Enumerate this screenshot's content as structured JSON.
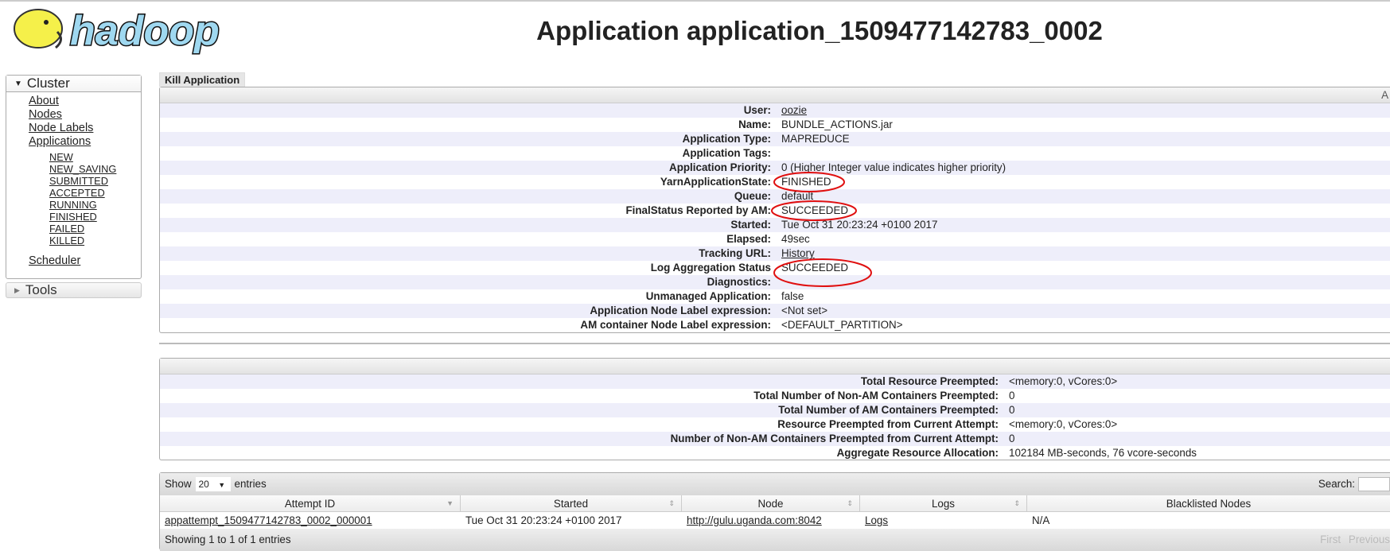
{
  "logo": {
    "text": "hadoop"
  },
  "title": "Application application_1509477142783_0002",
  "sidebar": {
    "cluster": "Cluster",
    "links": [
      "About",
      "Nodes",
      "Node Labels",
      "Applications"
    ],
    "states": [
      "NEW",
      "NEW_SAVING",
      "SUBMITTED",
      "ACCEPTED",
      "RUNNING",
      "FINISHED",
      "FAILED",
      "KILLED"
    ],
    "scheduler": "Scheduler",
    "tools": "Tools"
  },
  "kill_button": "Kill Application",
  "info_header": "A",
  "info": [
    {
      "label": "User:",
      "value": "oozie",
      "link": true
    },
    {
      "label": "Name:",
      "value": "BUNDLE_ACTIONS.jar"
    },
    {
      "label": "Application Type:",
      "value": "MAPREDUCE"
    },
    {
      "label": "Application Tags:",
      "value": ""
    },
    {
      "label": "Application Priority:",
      "value": "0 (Higher Integer value indicates higher priority)"
    },
    {
      "label": "YarnApplicationState:",
      "value": "FINISHED"
    },
    {
      "label": "Queue:",
      "value": "default"
    },
    {
      "label": "FinalStatus Reported by AM:",
      "value": "SUCCEEDED"
    },
    {
      "label": "Started:",
      "value": "Tue Oct 31 20:23:24 +0100 2017"
    },
    {
      "label": "Elapsed:",
      "value": "49sec"
    },
    {
      "label": "Tracking URL:",
      "value": "History",
      "link": true
    },
    {
      "label": "Log Aggregation Status",
      "value": "SUCCEEDED"
    },
    {
      "label": "Diagnostics:",
      "value": ""
    },
    {
      "label": "Unmanaged Application:",
      "value": "false"
    },
    {
      "label": "Application Node Label expression:",
      "value": "<Not set>"
    },
    {
      "label": "AM container Node Label expression:",
      "value": "<DEFAULT_PARTITION>"
    }
  ],
  "preemption": [
    {
      "label": "Total Resource Preempted:",
      "value": "<memory:0, vCores:0>"
    },
    {
      "label": "Total Number of Non-AM Containers Preempted:",
      "value": "0"
    },
    {
      "label": "Total Number of AM Containers Preempted:",
      "value": "0"
    },
    {
      "label": "Resource Preempted from Current Attempt:",
      "value": "<memory:0, vCores:0>"
    },
    {
      "label": "Number of Non-AM Containers Preempted from Current Attempt:",
      "value": "0"
    },
    {
      "label": "Aggregate Resource Allocation:",
      "value": "102184 MB-seconds, 76 vcore-seconds"
    }
  ],
  "attempts": {
    "show": "Show",
    "page_size": "20",
    "entries": "entries",
    "search": "Search:",
    "columns": [
      "Attempt ID",
      "Started",
      "Node",
      "Logs",
      "Blacklisted Nodes"
    ],
    "rows": [
      [
        "appattempt_1509477142783_0002_000001",
        "Tue Oct 31 20:23:24 +0100 2017",
        "http://gulu.uganda.com:8042",
        "Logs",
        "N/A"
      ]
    ],
    "footer": "Showing 1 to 1 of 1 entries",
    "first": "First",
    "previous": "Previous"
  },
  "annotation_color": "#e01010"
}
